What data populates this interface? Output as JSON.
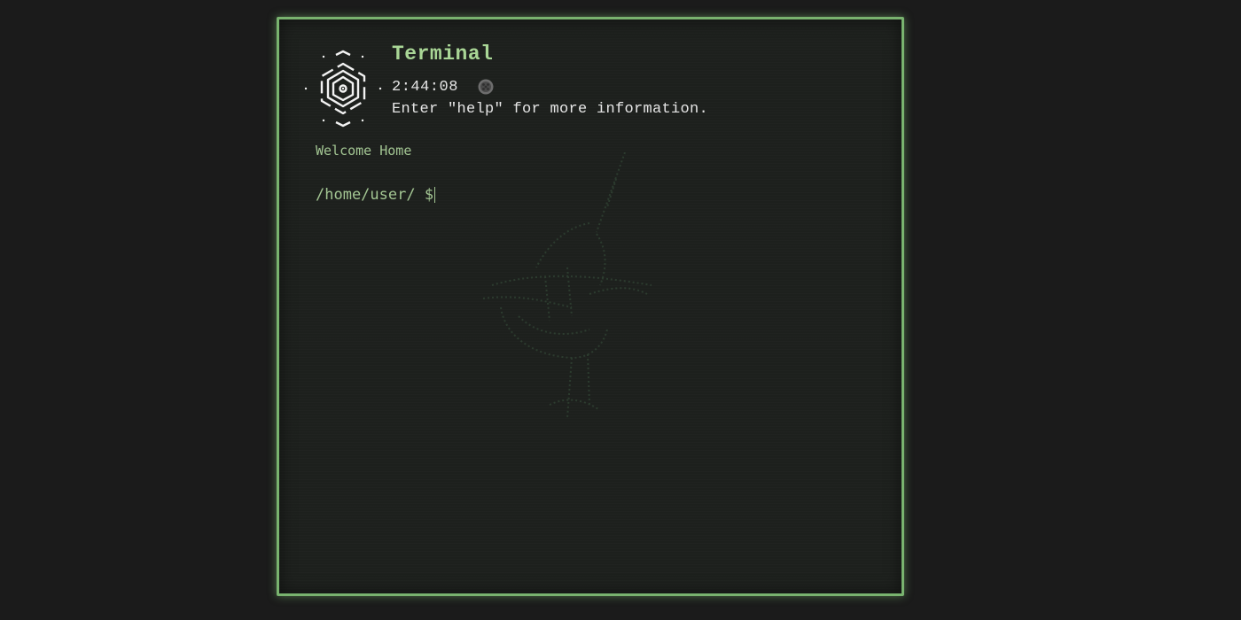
{
  "window": {
    "title": "Terminal",
    "clock": "2:44:08",
    "help_text": "Enter \"help\" for more information."
  },
  "console": {
    "welcome": "Welcome Home",
    "prompt": "/home/user/ $",
    "input_value": ""
  },
  "icons": {
    "logo": "geometric-mandala-logo-icon",
    "status": "status-orb-icon",
    "watermark": "ascii-bird-watermark"
  },
  "colors": {
    "background": "#1b1b1b",
    "terminal_bg": "#1d201d",
    "border_accent": "#79b36f",
    "title_green": "#a9d696",
    "text_green": "#a3c693",
    "text_white": "#e6e6e6"
  }
}
